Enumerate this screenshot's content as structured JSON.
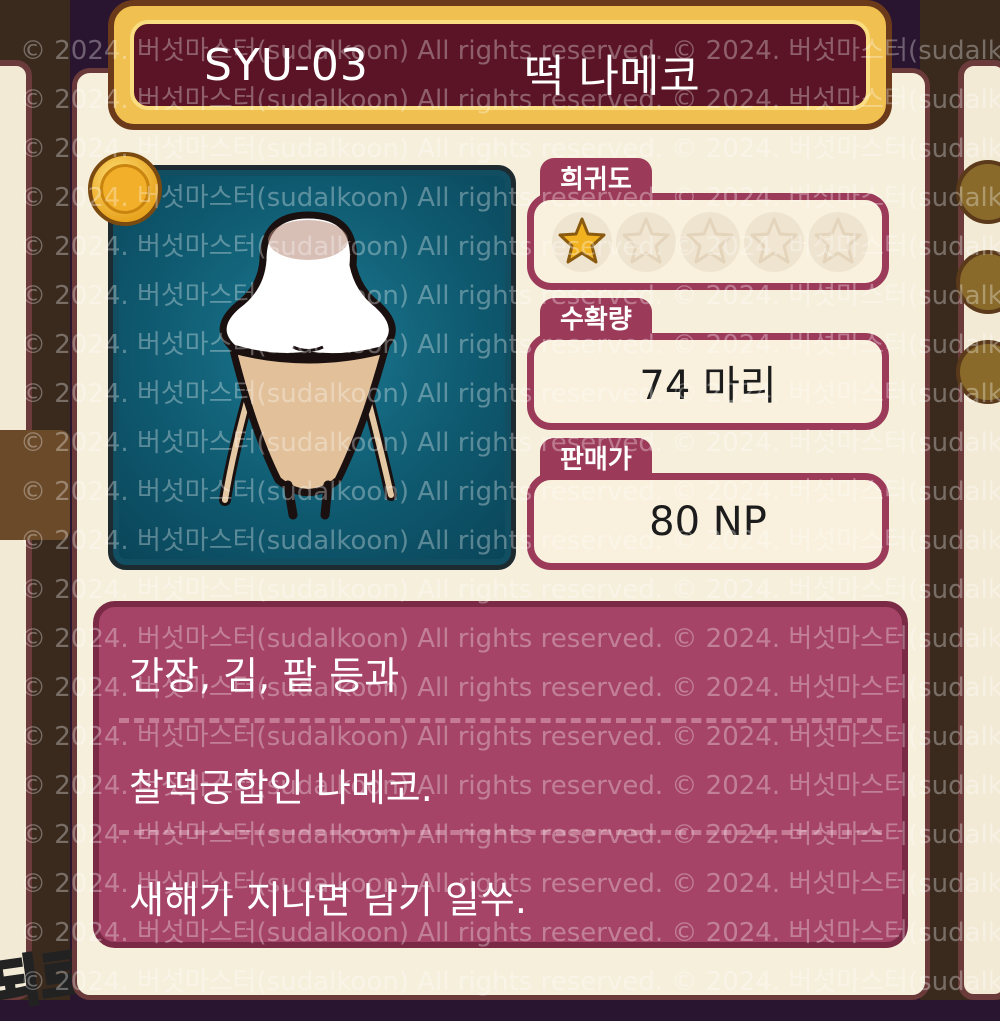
{
  "card": {
    "code": "SYU-03",
    "name": "떡 나메코"
  },
  "rarity": {
    "label": "희귀도",
    "stars_filled": 1,
    "stars_total": 5
  },
  "harvest": {
    "label": "수확량",
    "value": "74 마리"
  },
  "price": {
    "label": "판매가",
    "value": "80 NP"
  },
  "description": {
    "lines": [
      "간장, 김, 팥 등과",
      "찰떡궁합인 나메코.",
      "새해가 지나면 남기 일쑤."
    ]
  },
  "background": {
    "corner_text": "되로"
  },
  "watermark": "© 2024. 버섯마스터(sudalkoon) All rights reserved.",
  "colors": {
    "accent": "#9c3a5a",
    "banner_dark": "#5a1426",
    "gold": "#f0c050",
    "portrait_bg": "#0f5a70",
    "star_gold": "#f2b21f"
  }
}
